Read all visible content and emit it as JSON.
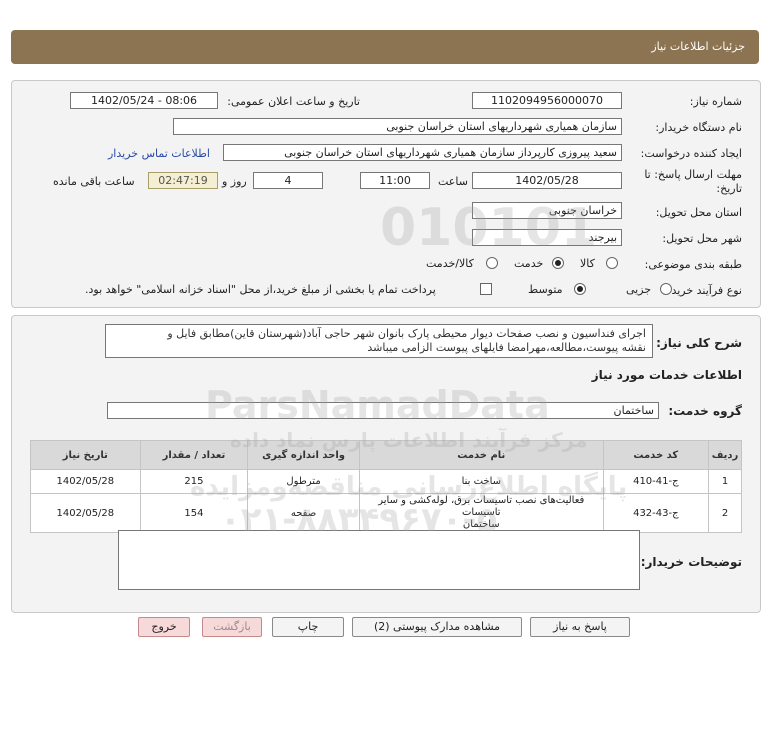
{
  "header": {
    "title": "جزئیات اطلاعات نیاز"
  },
  "details": {
    "need_number_label": "شماره نیاز:",
    "need_number": "1102094956000070",
    "announce_label": "تاریخ و ساعت اعلان عمومی:",
    "announce_value": "1402/05/24 - 08:06",
    "buyer_label": "نام دستگاه خریدار:",
    "buyer_value": "سازمان همیاری شهرداریهای استان خراسان جنوبی",
    "creator_label": "ایجاد کننده درخواست:",
    "creator_value": "سعید پیروزی کارپرداز سازمان همیاری شهرداریهای استان خراسان جنوبی",
    "contact_link": "اطلاعات تماس خریدار",
    "deadline_label_1": "مهلت ارسال پاسخ: تا",
    "deadline_label_2": "تاریخ:",
    "deadline_date": "1402/05/28",
    "time_label": "ساعت",
    "deadline_time": "11:00",
    "days_value": "4",
    "days_label": "روز و",
    "remaining_time": "02:47:19",
    "remaining_label": "ساعت باقی مانده",
    "province_label": "استان محل تحویل:",
    "province_value": "خراسان جنوبی",
    "city_label": "شهر محل تحویل:",
    "city_value": "بیرجند",
    "category_label": "طبقه بندی موضوعی:",
    "category_options": [
      "کالا",
      "خدمت",
      "کالا/خدمت"
    ],
    "category_selected": "خدمت",
    "process_label": "نوع فرآیند خرید :",
    "process_options": [
      "جزیی",
      "متوسط"
    ],
    "process_selected": "متوسط",
    "payment_note": "پرداخت تمام یا بخشی از مبلغ خرید،از محل \"اسناد خزانه اسلامی\" خواهد بود."
  },
  "description": {
    "label": "شرح کلی نیاز:",
    "line1": "اجرای فنداسیون و نصب صفحات دیوار محیطی پارک بانوان شهر حاجی آباد(شهرستان قاین)مطابق فایل و",
    "line2": "نقشه پیوست،مطالعه،مهرامضا فایلهای پیوست الزامی میباشد"
  },
  "services": {
    "section_title": "اطلاعات خدمات مورد نیاز",
    "group_label": "گروه خدمت:",
    "group_value": "ساختمان",
    "columns": [
      "ردیف",
      "کد خدمت",
      "نام خدمت",
      "واحد اندازه گیری",
      "تعداد / مقدار",
      "تاریخ نیاز"
    ],
    "rows": [
      {
        "row": "1",
        "code": "ج-41-410",
        "name": "ساخت بنا",
        "unit": "مترطول",
        "qty": "215",
        "date": "1402/05/28"
      },
      {
        "row": "2",
        "code": "ج-43-432",
        "name_line1": "فعالیت‌های نصب تاسیسات برق، لوله‌کشی و سایر تاسیسات",
        "name_line2": "ساختمان",
        "unit": "صفحه",
        "qty": "154",
        "date": "1402/05/28"
      }
    ]
  },
  "buyer_notes": {
    "label": "توضیحات خریدار:",
    "value": ""
  },
  "buttons": {
    "reply": "پاسخ به نیاز",
    "view_docs": "مشاهده مدارک پیوستی (2)",
    "print": "چاپ",
    "back": "بازگشت",
    "exit": "خروج"
  },
  "watermark": {
    "brand": "ParsNamadData",
    "line1": "مرکز فرآیند اطلاعات پارس نماد داده",
    "line2": "پایگاه اطلاع‌رسانی مناقصه‌ومزایده",
    "phone": "۰۲۱-۸۸۳۴۹۶۷۰-۵",
    "digits": "010101"
  },
  "colors": {
    "header_bg": "#8c7352",
    "link": "#2a4aa8",
    "timer_bg": "#f4efd2",
    "exit_bg": "#f8d9d9"
  }
}
